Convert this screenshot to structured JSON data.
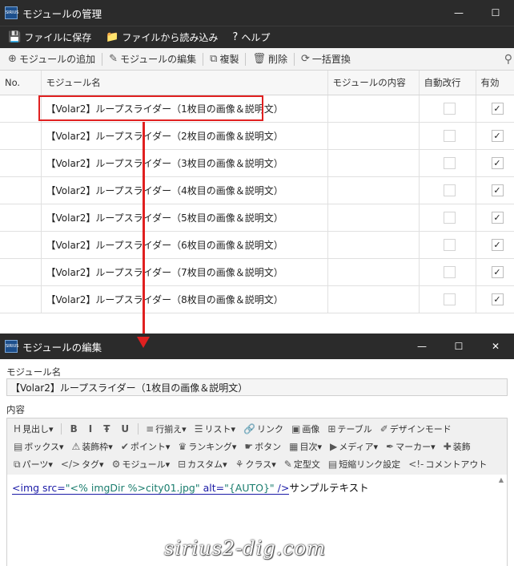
{
  "window1": {
    "title": "モジュールの管理",
    "controls": {
      "minimize": "—",
      "maximize": "☐",
      "close": ""
    },
    "menu": [
      {
        "icon": "save-icon",
        "glyph": "💾",
        "label": "ファイルに保存"
      },
      {
        "icon": "folder-icon",
        "glyph": "📁",
        "label": "ファイルから読み込み"
      },
      {
        "icon": "help-icon",
        "glyph": "?",
        "label": "ヘルプ"
      }
    ],
    "toolbar": [
      {
        "icon": "add-icon",
        "glyph": "⊕",
        "label": "モジュールの追加"
      },
      {
        "icon": "pencil-icon",
        "glyph": "✎",
        "label": "モジュールの編集"
      },
      {
        "icon": "duplicate-icon",
        "glyph": "⧉",
        "label": "複製"
      },
      {
        "icon": "trash-icon",
        "glyph": "🗑",
        "label": "削除"
      },
      {
        "icon": "replace-icon",
        "glyph": "⟳",
        "label": "一括置換"
      }
    ],
    "columns": [
      "No.",
      "モジュール名",
      "モジュールの内容",
      "自動改行",
      "有効"
    ],
    "rows": [
      {
        "name": "【Volar2】ループスライダー（1枚目の画像＆説明文）",
        "content": "",
        "auto_break": false,
        "enabled": true
      },
      {
        "name": "【Volar2】ループスライダー（2枚目の画像＆説明文）",
        "content": "",
        "auto_break": false,
        "enabled": true
      },
      {
        "name": "【Volar2】ループスライダー（3枚目の画像＆説明文）",
        "content": "",
        "auto_break": false,
        "enabled": true
      },
      {
        "name": "【Volar2】ループスライダー（4枚目の画像＆説明文）",
        "content": "",
        "auto_break": false,
        "enabled": true
      },
      {
        "name": "【Volar2】ループスライダー（5枚目の画像＆説明文）",
        "content": "",
        "auto_break": false,
        "enabled": true
      },
      {
        "name": "【Volar2】ループスライダー（6枚目の画像＆説明文）",
        "content": "",
        "auto_break": false,
        "enabled": true
      },
      {
        "name": "【Volar2】ループスライダー（7枚目の画像＆説明文）",
        "content": "",
        "auto_break": false,
        "enabled": true
      },
      {
        "name": "【Volar2】ループスライダー（8枚目の画像＆説明文）",
        "content": "",
        "auto_break": false,
        "enabled": true
      }
    ],
    "check_glyph": "✓"
  },
  "window2": {
    "title": "モジュールの編集",
    "controls": {
      "minimize": "—",
      "maximize": "☐",
      "close": "✕"
    },
    "name_label": "モジュール名",
    "name_value": "【Volar2】ループスライダー（1枚目の画像＆説明文）",
    "content_label": "内容",
    "editor_toolbar": [
      [
        {
          "icon": "heading-icon",
          "glyph": "H",
          "label": "見出し▾"
        },
        {
          "sep": true
        },
        {
          "icon": "bold-icon",
          "glyph": "B",
          "label": "",
          "big": true
        },
        {
          "icon": "italic-icon",
          "glyph": "I",
          "label": "",
          "big": true
        },
        {
          "icon": "strike-icon",
          "glyph": "Ŧ",
          "label": "",
          "big": true
        },
        {
          "icon": "underline-icon",
          "glyph": "U",
          "label": "",
          "big": true
        },
        {
          "sep": true
        },
        {
          "icon": "align-icon",
          "glyph": "≡",
          "label": "行揃え▾"
        },
        {
          "icon": "list-icon",
          "glyph": "☰",
          "label": "リスト▾"
        },
        {
          "icon": "link-icon",
          "glyph": "🔗",
          "label": "リンク"
        },
        {
          "icon": "image-icon",
          "glyph": "▣",
          "label": "画像"
        },
        {
          "icon": "table-icon",
          "glyph": "⊞",
          "label": "テーブル"
        },
        {
          "icon": "design-mode-icon",
          "glyph": "✐",
          "label": "デザインモード"
        }
      ],
      [
        {
          "icon": "box-icon",
          "glyph": "▤",
          "label": "ボックス▾"
        },
        {
          "icon": "decoration-icon",
          "glyph": "⚠",
          "label": "装飾枠▾"
        },
        {
          "icon": "point-icon",
          "glyph": "✔",
          "label": "ポイント▾"
        },
        {
          "icon": "ranking-icon",
          "glyph": "♛",
          "label": "ランキング▾"
        },
        {
          "icon": "button-icon",
          "glyph": "☛",
          "label": "ボタン"
        },
        {
          "icon": "toc-icon",
          "glyph": "▦",
          "label": "目次▾"
        },
        {
          "icon": "media-icon",
          "glyph": "▶",
          "label": "メディア▾"
        },
        {
          "icon": "marker-icon",
          "glyph": "✒",
          "label": "マーカー▾"
        },
        {
          "icon": "ornament-icon",
          "glyph": "✚",
          "label": "装飾"
        }
      ],
      [
        {
          "icon": "parts-icon",
          "glyph": "⧉",
          "label": "パーツ▾"
        },
        {
          "icon": "tag-icon",
          "glyph": "</>",
          "label": "タグ▾"
        },
        {
          "icon": "module-icon",
          "glyph": "⚙",
          "label": "モジュール▾"
        },
        {
          "icon": "custom-icon",
          "glyph": "⊟",
          "label": "カスタム▾"
        },
        {
          "icon": "class-icon",
          "glyph": "⚘",
          "label": "クラス▾"
        },
        {
          "icon": "template-icon",
          "glyph": "✎",
          "label": "定型文"
        },
        {
          "icon": "shortlink-icon",
          "glyph": "▤",
          "label": "短縮リンク設定"
        },
        {
          "icon": "comment-out-icon",
          "glyph": "<!-",
          "label": "コメントアウト"
        }
      ]
    ],
    "code": {
      "tag_open": "<img",
      "attr_src": " src=",
      "val_src": "\"<% imgDir %>city01.jpg\"",
      "attr_alt": " alt=",
      "val_alt": "\"{AUTO}\"",
      "tag_close": " />",
      "text": "サンプルテキスト"
    },
    "watermark": "sirius2-dig.com"
  }
}
